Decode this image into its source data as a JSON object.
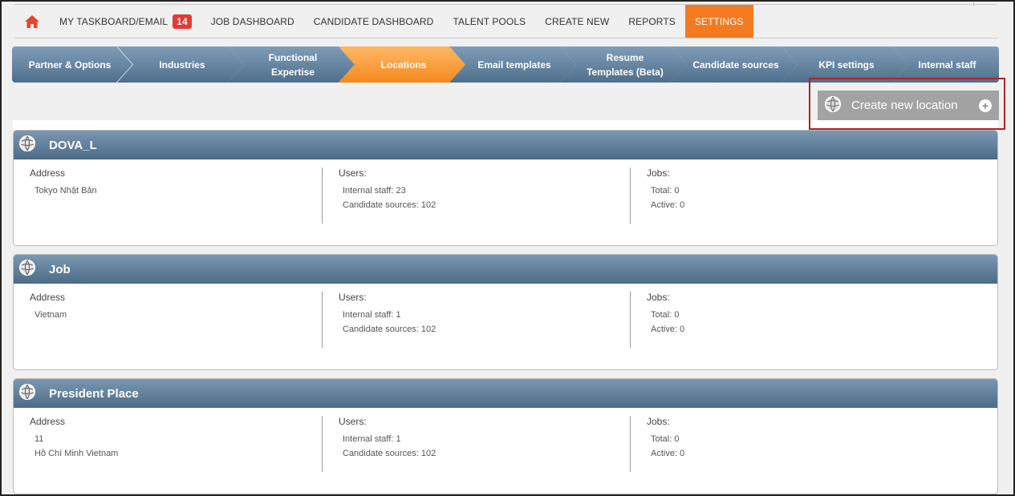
{
  "topnav": {
    "items": [
      {
        "label": "MY TASKBOARD/EMAIL",
        "badge": "14"
      },
      {
        "label": "JOB DASHBOARD"
      },
      {
        "label": "CANDIDATE DASHBOARD"
      },
      {
        "label": "TALENT POOLS"
      },
      {
        "label": "CREATE NEW"
      },
      {
        "label": "REPORTS"
      },
      {
        "label": "SETTINGS"
      }
    ],
    "active_color": "#f47a20"
  },
  "steps": [
    {
      "label": "Partner & Options"
    },
    {
      "label": "Industries"
    },
    {
      "label": "Functional Expertise"
    },
    {
      "label": "Locations"
    },
    {
      "label": "Email templates"
    },
    {
      "label": "Resume Templates (Beta)"
    },
    {
      "label": "Candidate sources"
    },
    {
      "label": "KPI settings"
    },
    {
      "label": "Internal staff"
    }
  ],
  "create_button": {
    "label": "Create new location",
    "icon": "globe-icon",
    "plus": "+"
  },
  "locations": [
    {
      "name": "DOVA_L",
      "address_title": "Address",
      "address_lines": [
        "Tokyo Nhật Bản",
        ""
      ],
      "users_title": "Users:",
      "users_lines": [
        "Internal staff: 23",
        "Candidate sources: 102"
      ],
      "jobs_title": "Jobs:",
      "jobs_lines": [
        "Total: 0",
        "Active: 0"
      ]
    },
    {
      "name": "Job",
      "address_title": "Address",
      "address_lines": [
        "Vietnam",
        ""
      ],
      "users_title": "Users:",
      "users_lines": [
        "Internal staff: 1",
        "Candidate sources: 102"
      ],
      "jobs_title": "Jobs:",
      "jobs_lines": [
        "Total: 0",
        "Active: 0"
      ]
    },
    {
      "name": "President Place",
      "address_title": "Address",
      "address_lines": [
        "11",
        "Hồ Chí Minh Vietnam"
      ],
      "users_title": "Users:",
      "users_lines": [
        "Internal staff: 1",
        "Candidate sources: 102"
      ],
      "jobs_title": "Jobs:",
      "jobs_lines": [
        "Total: 0",
        "Active: 0"
      ]
    }
  ]
}
